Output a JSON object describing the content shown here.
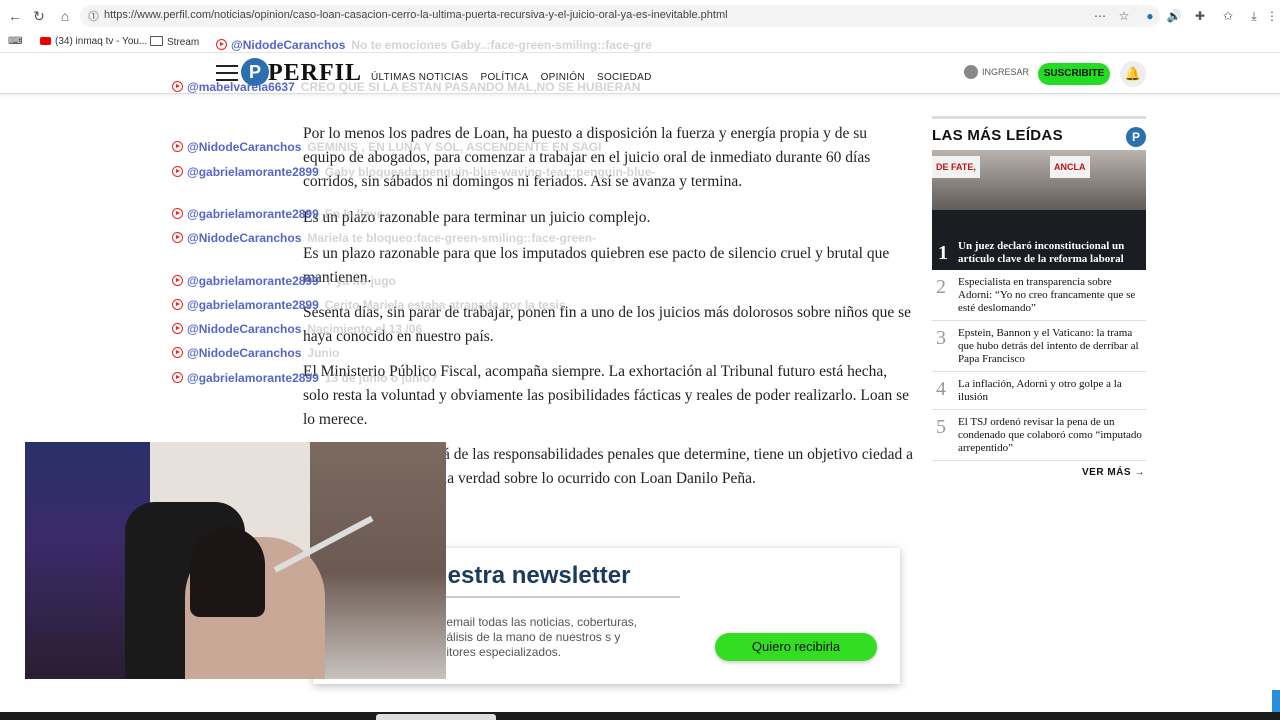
{
  "browser": {
    "url": "https://www.perfil.com/noticias/opinion/caso-loan-casacion-cerro-la-ultima-puerta-recursiva-y-el-juicio-oral-ya-es-inevitable.phtml",
    "bookmarks": [
      "(34) inmaq tv - You...",
      "Stream"
    ]
  },
  "site": {
    "logo": "PERFIL",
    "logo_mark": "P",
    "nav": [
      "ÚLTIMAS NOTICIAS",
      "POLÍTICA",
      "OPINIÓN",
      "SOCIEDAD"
    ],
    "login_label": "INGRESAR",
    "subscribe_label": "SUSCRIBITE"
  },
  "article": {
    "paragraphs": [
      "Por lo menos los padres de Loan, ha puesto a disposición la fuerza y energía propia y de su equipo de abogados, para comenzar a trabajar en el juicio oral de inmediato durante 60 días corridos, sin sábados ni domingos ni feriados. Así se avanza y termina.",
      "Es un plazo razonable para terminar un juicio complejo.",
      "Es un plazo razonable para que los imputados quiebren ese pacto de silencio cruel y brutal que mantienen.",
      "Sesenta días, sin parar de trabajar, ponen fin a uno de los juicios más dolorosos sobre niños que se haya conocido en nuestro país.",
      "El Ministerio Público Fiscal, acompaña siempre. La exhortación al Tribunal futuro está hecha, solo resta la voluntad y obviamente las posibilidades fácticas y reales de poder realizarlo. Loan se lo merece.",
      "á de las responsabilidades penales que determine, tiene un objetivo ciedad a la verdad sobre lo ocurrido con Loan Danilo Peña."
    ]
  },
  "sidebar": {
    "title": "LAS MÁS LEÍDAS",
    "feature": {
      "number": "1",
      "title": "Un juez declaró inconstitucional un artículo clave de la reforma laboral",
      "banner_left": "DE FATE,",
      "banner_right": "ANCLA"
    },
    "items": [
      {
        "number": "2",
        "title": "Especialista en transparencia sobre Adorni: “Yo no creo francamente que se esté deslomando”"
      },
      {
        "number": "3",
        "title": "Epstein, Bannon y el Vaticano: la trama que hubo detrás del intento de derribar al Papa Francisco"
      },
      {
        "number": "4",
        "title": "La inflación, Adorni y otro golpe a la ilusión"
      },
      {
        "number": "5",
        "title": "El TSJ ordenó revisar la pena de un condenado que colaboró como “imputado arrepentido”"
      }
    ],
    "more_label": "VER MÁS"
  },
  "newsletter": {
    "title": "uestra newsletter",
    "description": "tu email todas las noticias, coberturas, análisis de la mano de nuestros s y editores especializados.",
    "button": "Quiero recibirla"
  },
  "chat": [
    {
      "user": "@NidodeCaranchos",
      "text": "No te emociones Gaby..:face-green-smiling::face-gre"
    },
    {
      "user": "@mabelvarela6637",
      "text": "CREO QUE SI LA ESTAN PASANDO MAL,NO SE HUBIERAN"
    },
    {
      "user": "@NidodeCaranchos",
      "text": "GEMINIS , EN LUNA Y SOL, ASCENDENTE EN SAGI"
    },
    {
      "user": "@gabrielamorante2899",
      "text": "Gaby bloqueada:penguin-blue-waving-tear::penguin-blue-"
    },
    {
      "user": "@gabrielamorante2899",
      "text": "En la llave"
    },
    {
      "user": "@NidodeCaranchos",
      "text": "Mariela te bloqueo:face-green-smiling::face-green-"
    },
    {
      "user": "@gabrielamorante2899",
      "text": "Y ya no jugo"
    },
    {
      "user": "@gabrielamorante2899",
      "text": "Cerito Mariela estaba atrapada por la tesis"
    },
    {
      "user": "@NidodeCaranchos",
      "text": "Nacimiento el 13 /06"
    },
    {
      "user": "@NidodeCaranchos",
      "text": "Junio"
    },
    {
      "user": "@gabrielamorante2899",
      "text": "13 de junio o junio?"
    }
  ],
  "colors": {
    "brand_blue": "#2a6fb0",
    "subscribe_green": "#22dd22",
    "chat_user": "#5566cc",
    "newsletter_title": "#1a3b5c"
  }
}
